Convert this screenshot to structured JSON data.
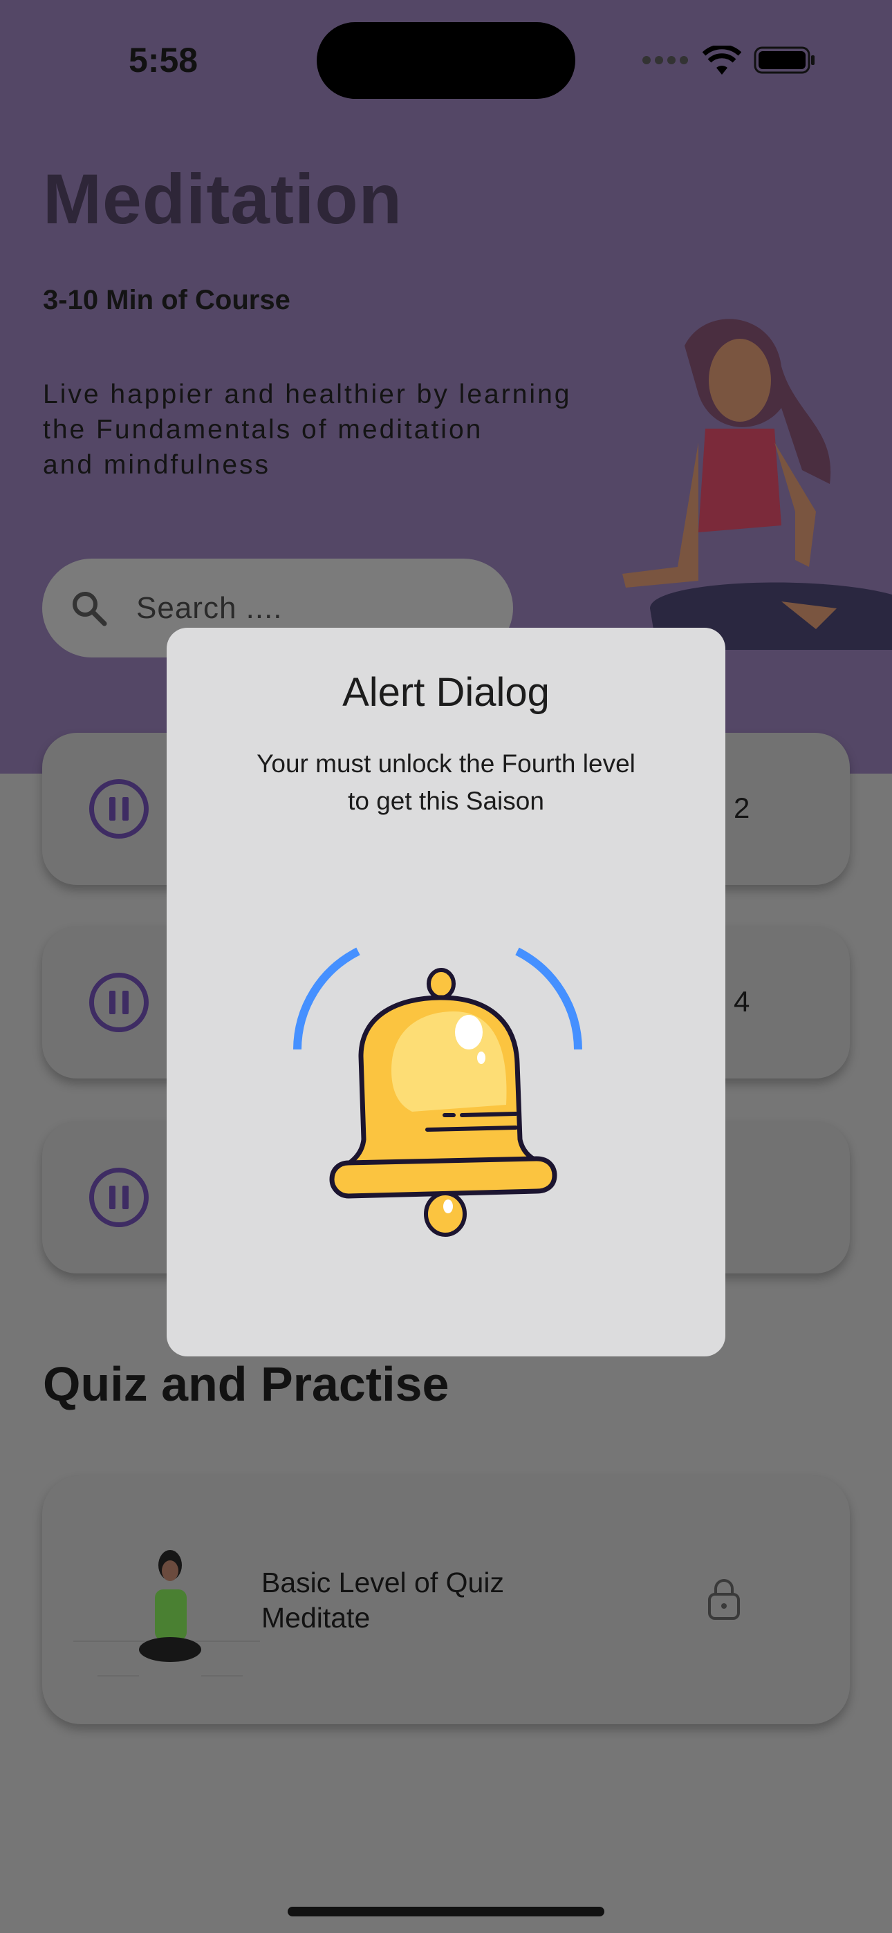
{
  "status_bar": {
    "time": "5:58"
  },
  "header": {
    "title": "Meditation",
    "subtitle": "3-10 Min of Course",
    "description_lines": [
      "Live happier and healthier by learning",
      "the Fundamentals of meditation",
      "and mindfulness"
    ]
  },
  "search": {
    "placeholder": "Search ...."
  },
  "sessions": [
    {
      "label_visible": "2",
      "icon": "pause-icon"
    },
    {
      "label_visible": "4",
      "icon": "pause-icon"
    },
    {
      "label_visible": "",
      "icon": "pause-icon"
    }
  ],
  "quiz": {
    "section_title": "Quiz and Practise",
    "card_title_lines": [
      "Basic Level of Quiz",
      "Meditate"
    ],
    "icon": "lock-icon"
  },
  "dialog": {
    "title": "Alert Dialog",
    "message_lines": [
      "Your must unlock the Fourth level",
      "to get this Saison"
    ],
    "icon": "bell-icon"
  },
  "colors": {
    "header": "#544766",
    "accent": "#3e2c63",
    "bell": "#fbc440",
    "ring": "#4590ff"
  }
}
